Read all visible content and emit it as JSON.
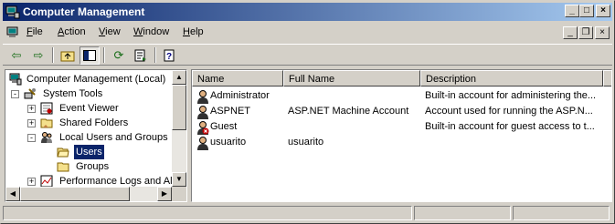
{
  "window": {
    "title": "Computer Management"
  },
  "menu": [
    {
      "label": "File",
      "mnemonic": "F",
      "rest": "ile"
    },
    {
      "label": "Action",
      "mnemonic": "A",
      "rest": "ction"
    },
    {
      "label": "View",
      "mnemonic": "V",
      "rest": "iew"
    },
    {
      "label": "Window",
      "mnemonic": "W",
      "rest": "indow"
    },
    {
      "label": "Help",
      "mnemonic": "H",
      "rest": "elp"
    }
  ],
  "tree": [
    {
      "label": "Computer Management (Local)",
      "icon": "computer-icon",
      "expander": "-"
    },
    {
      "label": "System Tools",
      "icon": "tools-icon",
      "expander": "-"
    },
    {
      "label": "Event Viewer",
      "icon": "event-viewer-icon",
      "expander": "+"
    },
    {
      "label": "Shared Folders",
      "icon": "folder-icon",
      "expander": "+"
    },
    {
      "label": "Local Users and Groups",
      "icon": "users-groups-icon",
      "expander": "-"
    },
    {
      "label": "Users",
      "icon": "folder-open-icon",
      "expander": "",
      "selected": true
    },
    {
      "label": "Groups",
      "icon": "folder-icon",
      "expander": ""
    },
    {
      "label": "Performance Logs and Ale",
      "icon": "performance-icon",
      "expander": "+"
    }
  ],
  "list": {
    "columns": [
      "Name",
      "Full Name",
      "Description"
    ],
    "rows": [
      {
        "name": "Administrator",
        "full_name": "",
        "description": "Built-in account for administering the...",
        "icon": "user-icon"
      },
      {
        "name": "ASPNET",
        "full_name": "ASP.NET Machine Account",
        "description": "Account used for running the ASP.N...",
        "icon": "user-icon"
      },
      {
        "name": "Guest",
        "full_name": "",
        "description": "Built-in account for guest access to t...",
        "icon": "disabled-user-icon"
      },
      {
        "name": "usuarito",
        "full_name": "usuarito",
        "description": "",
        "icon": "user-icon"
      }
    ]
  },
  "colors": {
    "title_start": "#0a246a",
    "title_end": "#a6caf0",
    "face": "#d4d0c8",
    "selection": "#0a246a"
  }
}
